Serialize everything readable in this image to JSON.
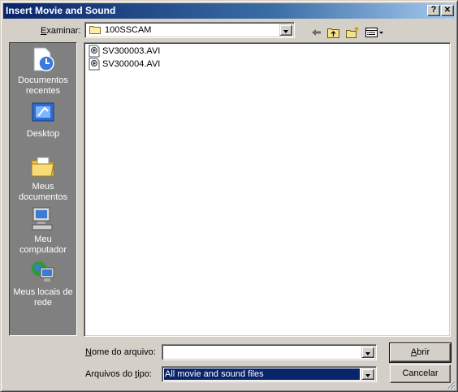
{
  "window": {
    "title": "Insert Movie and Sound",
    "help_glyph": "?",
    "close_glyph": "✕"
  },
  "lookin": {
    "label_prefix": "",
    "label_underlined": "E",
    "label_rest": "xaminar:",
    "value": "100SSCAM"
  },
  "places": [
    {
      "id": "recent",
      "label": "Documentos recentes",
      "icon": "recent-documents-icon"
    },
    {
      "id": "desktop",
      "label": "Desktop",
      "icon": "desktop-icon"
    },
    {
      "id": "mydocs",
      "label": "Meus documentos",
      "icon": "my-documents-icon"
    },
    {
      "id": "mycomputer",
      "label": "Meu computador",
      "icon": "my-computer-icon"
    },
    {
      "id": "network",
      "label": "Meus locais de rede",
      "icon": "network-places-icon"
    }
  ],
  "files": [
    {
      "name": "SV300003.AVI",
      "icon": "video-file-icon"
    },
    {
      "name": "SV300004.AVI",
      "icon": "video-file-icon"
    }
  ],
  "filename": {
    "label_prefix": "",
    "label_underlined": "N",
    "label_rest": "ome do arquivo:",
    "value": ""
  },
  "filetype": {
    "label_prefix": "Arquivos do ",
    "label_underlined": "t",
    "label_rest": "ipo:",
    "value": "All movie and sound files"
  },
  "buttons": {
    "open_prefix": "",
    "open_underlined": "A",
    "open_rest": "brir",
    "cancel": "Cancelar"
  },
  "colors": {
    "titlebar_start": "#0a246a",
    "titlebar_end": "#a6caf0",
    "face": "#d4d0c8",
    "places_bg": "#808080",
    "selection": "#0a246a"
  }
}
